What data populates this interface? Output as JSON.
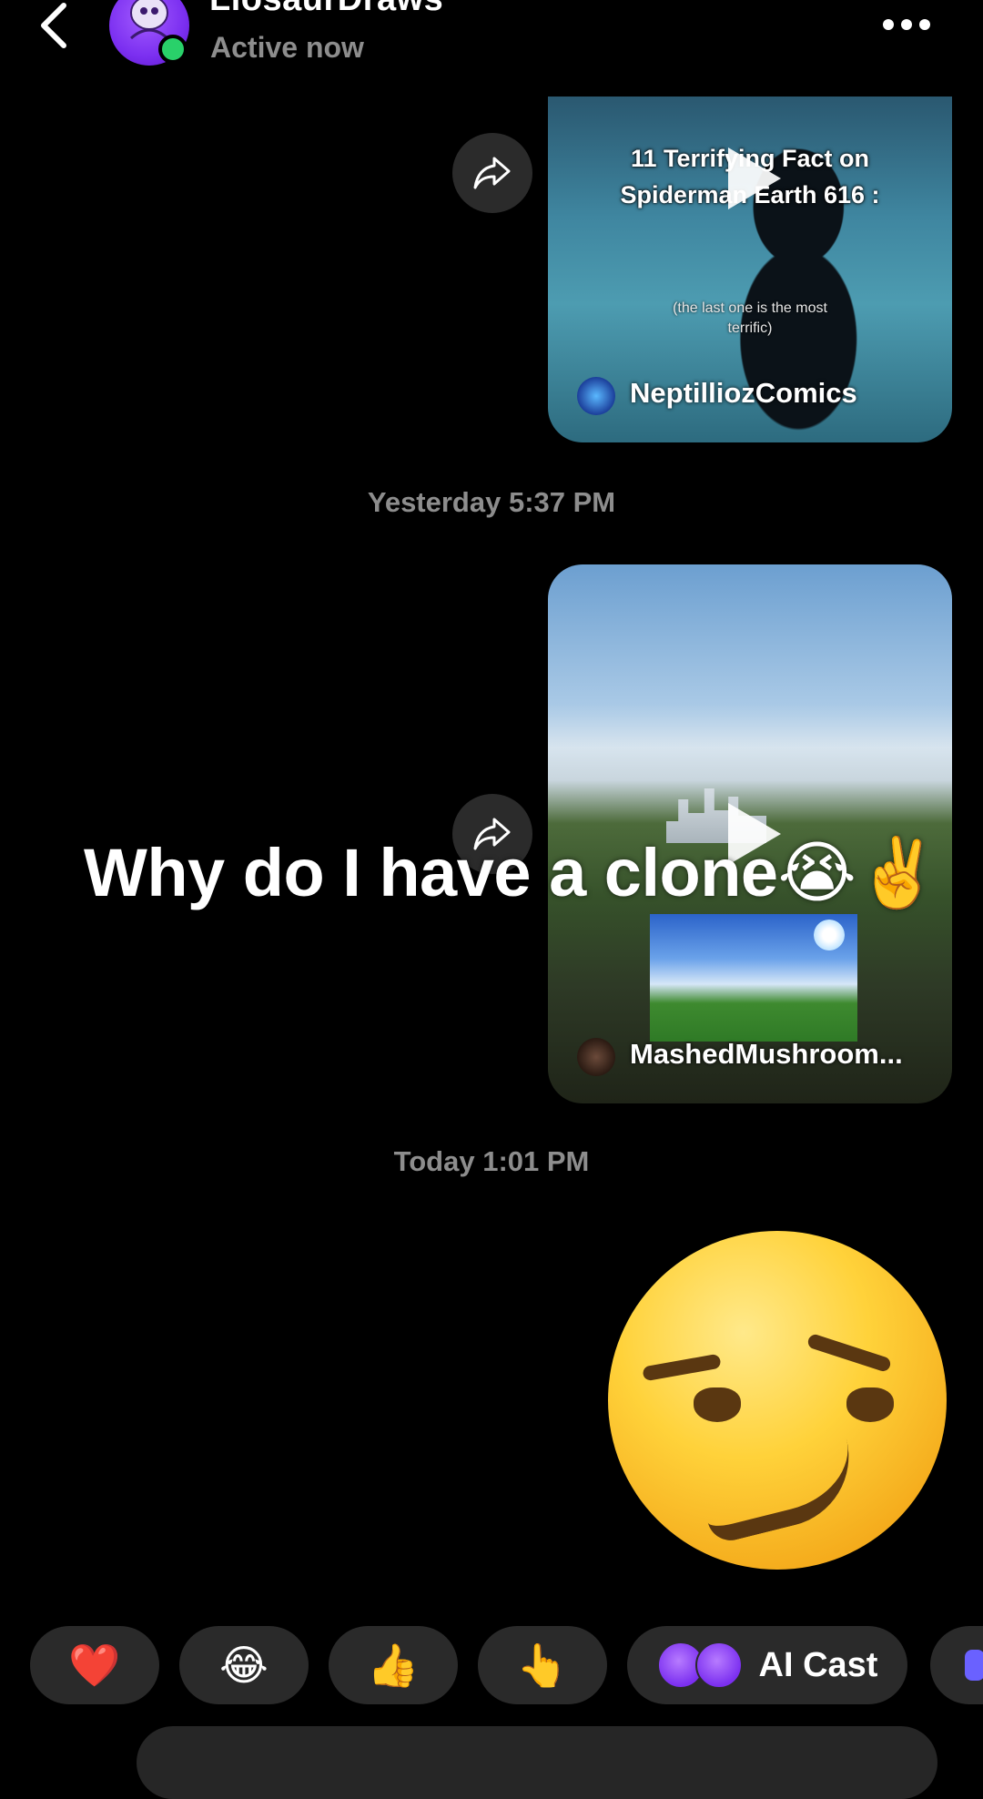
{
  "header": {
    "contact_name": "LiosaurDraws",
    "status": "Active now"
  },
  "messages": {
    "video1": {
      "title_line1": "11 Terrifying Fact on",
      "title_line2": "Spiderman Earth 616 :",
      "subtitle_line1": "(the last one is the most",
      "subtitle_line2": "terrific)",
      "author": "NeptilliozComics"
    },
    "timestamp1": "Yesterday 5:37 PM",
    "video2": {
      "author": "MashedMushroom..."
    },
    "timestamp2": "Today 1:01 PM",
    "big_emoji": "smirking-face"
  },
  "overlay_caption": "Why do I have a clone😭✌️",
  "reactions": {
    "items": [
      "❤️",
      "😂",
      "👍",
      "👆"
    ],
    "ai_cast_label": "AI Cast"
  },
  "colors": {
    "background": "#000000",
    "secondary_text": "#8d8d8d",
    "chip_background": "#2a2a2a",
    "online": "#29d16a",
    "avatar": "#7b2ff0"
  }
}
